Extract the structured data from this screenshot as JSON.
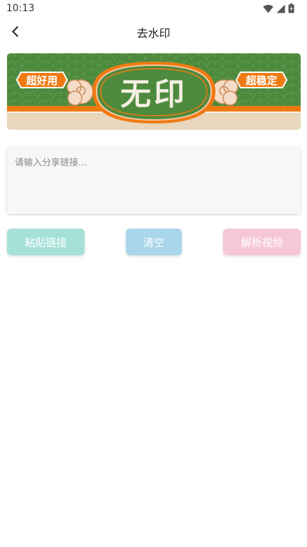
{
  "status_bar": {
    "time": "10:13"
  },
  "header": {
    "title": "去水印"
  },
  "banner": {
    "left_tag": "超好用",
    "right_tag": "超稳定",
    "center_text": "无印"
  },
  "input": {
    "placeholder": "请输入分享链接...",
    "value": ""
  },
  "buttons": {
    "paste": "粘贴链接",
    "clear": "清空",
    "parse": "解析视频"
  },
  "colors": {
    "paste_button": "#a6e1d9",
    "clear_button": "#a9d6ea",
    "parse_button": "#f6c8d5",
    "banner_green": "#4e8a3e",
    "banner_orange": "#f07a12",
    "banner_cream": "#e8d7bd"
  }
}
